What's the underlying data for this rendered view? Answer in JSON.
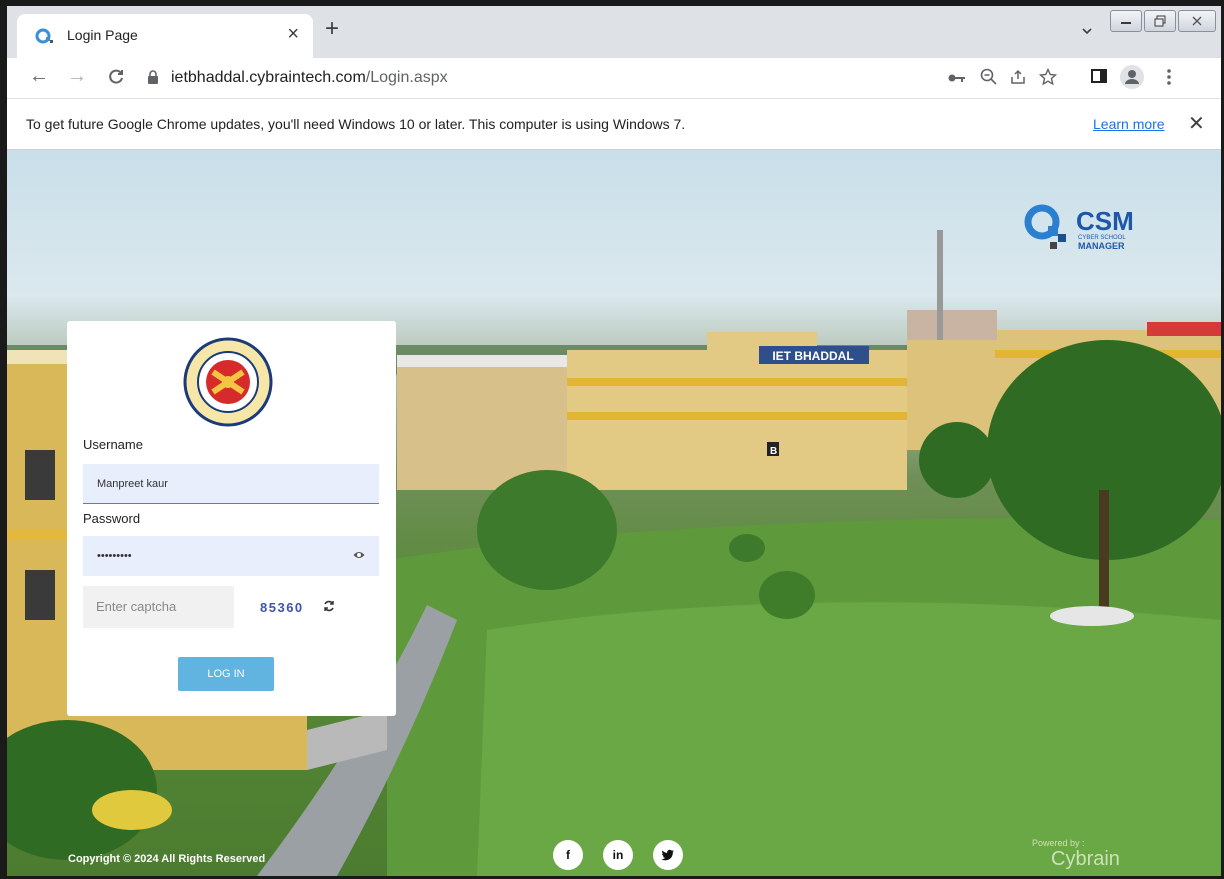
{
  "browser": {
    "tab_title": "Login Page",
    "url_host": "ietbhaddal.cybraintech.com",
    "url_path": "/Login.aspx",
    "infobar_text": "To get future Google Chrome updates, you'll need Windows 10 or later. This computer is using Windows 7.",
    "learn_more": "Learn more"
  },
  "page": {
    "building_sign": "IET BHADDAL",
    "csm_logo": {
      "title": "CSM",
      "sub1": "CYBER SCHOOL",
      "sub2": "MANAGER"
    },
    "form": {
      "username_label": "Username",
      "username_value": "Manpreet kaur",
      "password_label": "Password",
      "password_value": "•••••••••",
      "captcha_placeholder": "Enter captcha",
      "captcha_code": "85360",
      "login_label": "LOG IN"
    },
    "footer": {
      "copyright": "Copyright © 2024 All Rights Reserved",
      "social": [
        "f",
        "in"
      ],
      "powered_by": "Powered by :",
      "brand": "Cybrain"
    }
  },
  "colors": {
    "accent": "#62b4e0",
    "captcha": "#3b57a6",
    "link": "#1a73e8"
  }
}
